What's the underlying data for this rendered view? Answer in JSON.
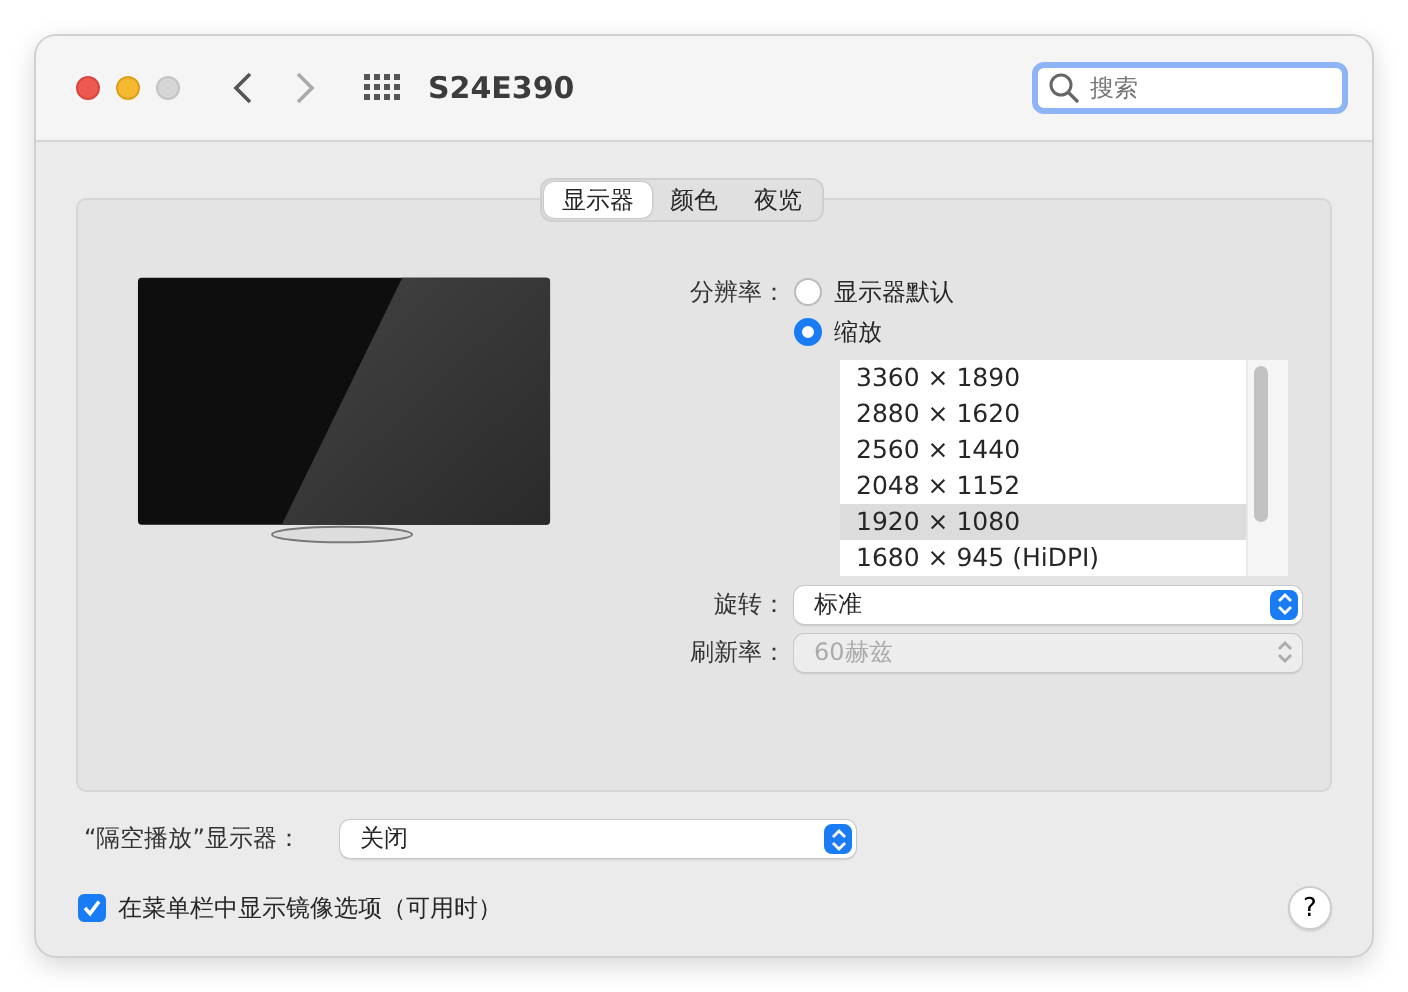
{
  "window": {
    "title": "S24E390"
  },
  "search": {
    "placeholder": "搜索"
  },
  "tabs": [
    {
      "label": "显示器",
      "selected": true
    },
    {
      "label": "颜色",
      "selected": false
    },
    {
      "label": "夜览",
      "selected": false
    }
  ],
  "resolution": {
    "label": "分辨率：",
    "options": [
      {
        "label": "显示器默认",
        "selected": false
      },
      {
        "label": "缩放",
        "selected": true
      }
    ],
    "list": [
      {
        "label": "3360 × 1890",
        "selected": false
      },
      {
        "label": "2880 × 1620",
        "selected": false
      },
      {
        "label": "2560 × 1440",
        "selected": false
      },
      {
        "label": "2048 × 1152",
        "selected": false
      },
      {
        "label": "1920 × 1080",
        "selected": true
      },
      {
        "label": "1680 × 945 (HiDPI)",
        "selected": false
      }
    ]
  },
  "popups": [
    {
      "label": "旋转：",
      "value": "标准",
      "disabled": false
    },
    {
      "label": "刷新率：",
      "value": "60赫兹",
      "disabled": true
    }
  ],
  "airplay": {
    "label": "“隔空播放”显示器：",
    "value": "关闭",
    "disabled": false
  },
  "mirror": {
    "label": "在菜单栏中显示镜像选项（可用时）",
    "checked": true
  },
  "help": "?"
}
